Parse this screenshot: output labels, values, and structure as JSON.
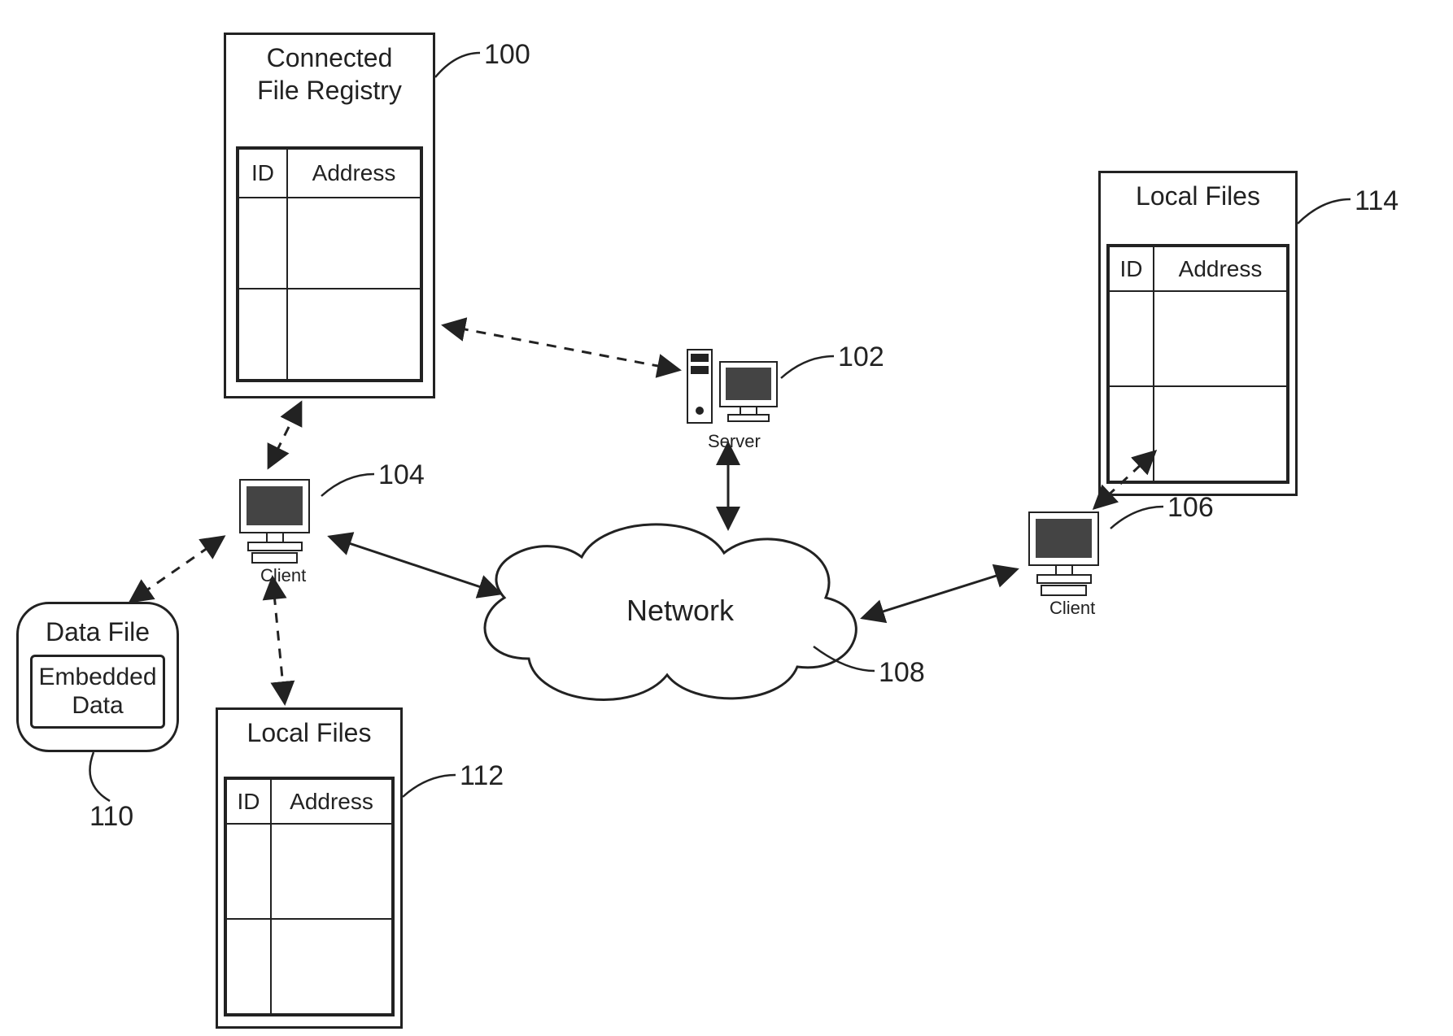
{
  "registry": {
    "title": "Connected\nFile Registry",
    "col_id": "ID",
    "col_addr": "Address",
    "ref": "100"
  },
  "server": {
    "ref": "102",
    "caption": "Server"
  },
  "client1": {
    "ref": "104",
    "caption": "Client"
  },
  "client2": {
    "ref": "106",
    "caption": "Client"
  },
  "network": {
    "label": "Network",
    "ref": "108"
  },
  "datafile": {
    "title": "Data File",
    "inner": "Embedded\nData",
    "ref": "110"
  },
  "localfiles1": {
    "title": "Local Files",
    "col_id": "ID",
    "col_addr": "Address",
    "ref": "112"
  },
  "localfiles2": {
    "title": "Local Files",
    "col_id": "ID",
    "col_addr": "Address",
    "ref": "114"
  }
}
